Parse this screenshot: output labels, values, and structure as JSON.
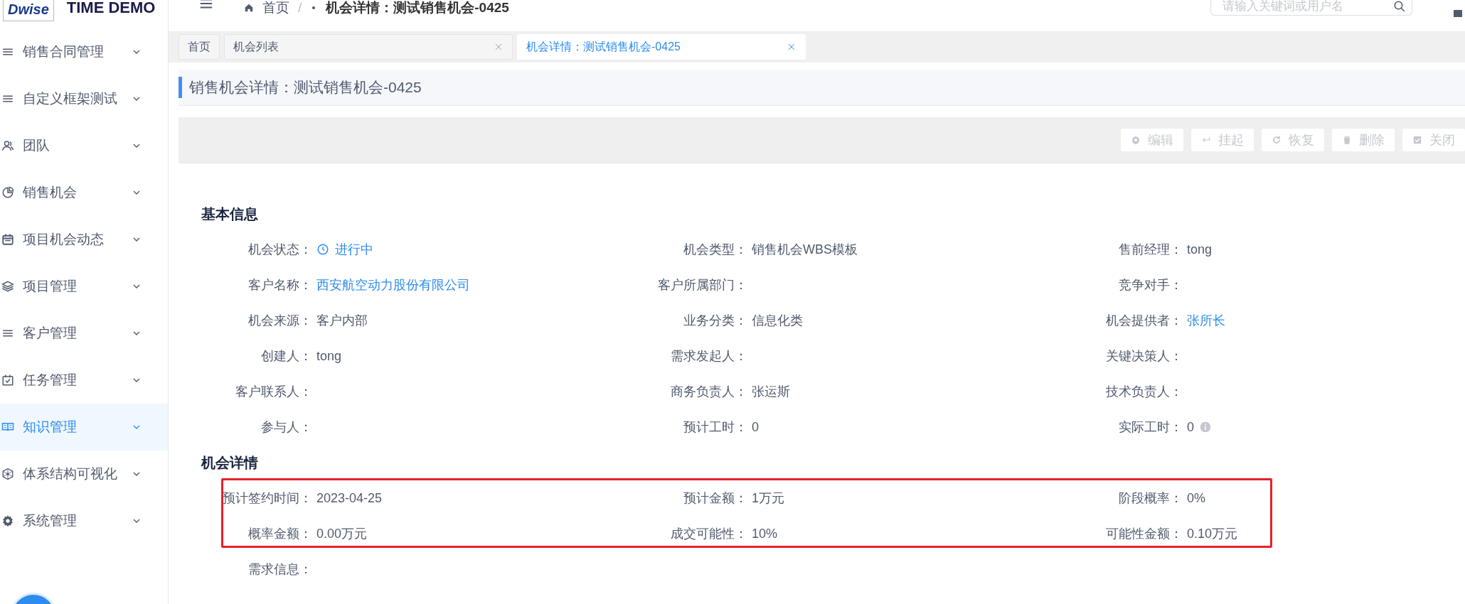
{
  "header": {
    "logo": "Dwise",
    "app_title": "TIME DEMO",
    "breadcrumb": [
      "首页",
      "机会详情：测试销售机会-0425"
    ],
    "breadcrumb_separator": "/",
    "search": {
      "placeholder": "请输入关键词或用户名"
    }
  },
  "sidebar": {
    "items": [
      {
        "label": "销售合同管理",
        "selected": false
      },
      {
        "label": "自定义框架测试",
        "selected": false
      },
      {
        "label": "团队",
        "selected": false
      },
      {
        "label": "销售机会",
        "selected": false
      },
      {
        "label": "项目机会动态",
        "selected": false
      },
      {
        "label": "项目管理",
        "selected": false
      },
      {
        "label": "客户管理",
        "selected": false
      },
      {
        "label": "任务管理",
        "selected": false
      },
      {
        "label": "知识管理",
        "selected": true
      },
      {
        "label": "体系结构可视化",
        "selected": false
      },
      {
        "label": "系统管理",
        "selected": false
      }
    ]
  },
  "tabs": [
    {
      "label": "首页",
      "selected": false,
      "closable": false
    },
    {
      "label": "机会列表",
      "selected": false,
      "closable": true
    },
    {
      "label": "机会详情：测试销售机会-0425",
      "selected": true,
      "closable": true
    }
  ],
  "page_title": "销售机会详情：测试销售机会-0425",
  "toolbar": {
    "buttons": [
      {
        "label": "编辑",
        "disabled": true
      },
      {
        "label": "挂起",
        "disabled": true
      },
      {
        "label": "恢复",
        "disabled": true
      },
      {
        "label": "删除",
        "disabled": true
      },
      {
        "label": "关闭",
        "disabled": true
      }
    ]
  },
  "basic_info": {
    "title": "基本信息",
    "fields": [
      {
        "label": "机会状态：",
        "value": "进行中",
        "kind": "status"
      },
      {
        "label": "机会类型：",
        "value": "销售机会WBS模板",
        "kind": "text"
      },
      {
        "label": "售前经理：",
        "value": "tong",
        "kind": "text"
      },
      {
        "label": "客户名称：",
        "value": "西安航空动力股份有限公司",
        "kind": "link"
      },
      {
        "label": "客户所属部门："
      },
      {
        "label": "竞争对手："
      },
      {
        "label": "机会来源：",
        "value": "客户内部",
        "kind": "text"
      },
      {
        "label": "业务分类：",
        "value": "信息化类",
        "kind": "text"
      },
      {
        "label": "机会提供者：",
        "value": "张所长",
        "kind": "link"
      },
      {
        "label": "创建人：",
        "value": "tong",
        "kind": "text"
      },
      {
        "label": "需求发起人："
      },
      {
        "label": "关键决策人："
      },
      {
        "label": "客户联系人："
      },
      {
        "label": "商务负责人：",
        "value": "张运斯",
        "kind": "text"
      },
      {
        "label": "技术负责人："
      },
      {
        "label": "参与人："
      },
      {
        "label": "预计工时：",
        "value": "0",
        "kind": "text"
      },
      {
        "label": "实际工时：",
        "value": "0",
        "kind": "info"
      }
    ]
  },
  "opportunity_details": {
    "title": "机会详情",
    "highlighted": true,
    "fields": [
      {
        "label": "预计签约时间：",
        "value": "2023-04-25",
        "kind": "text"
      },
      {
        "label": "预计金额：",
        "value": "1万元",
        "kind": "text"
      },
      {
        "label": "阶段概率：",
        "value": "0%",
        "kind": "text"
      },
      {
        "label": "概率金额：",
        "value": "0.00万元",
        "kind": "text"
      },
      {
        "label": "成交可能性：",
        "value": "10%",
        "kind": "text"
      },
      {
        "label": "可能性金额：",
        "value": "0.10万元",
        "kind": "text"
      }
    ],
    "extra_fields": [
      {
        "label": "需求信息："
      }
    ]
  }
}
